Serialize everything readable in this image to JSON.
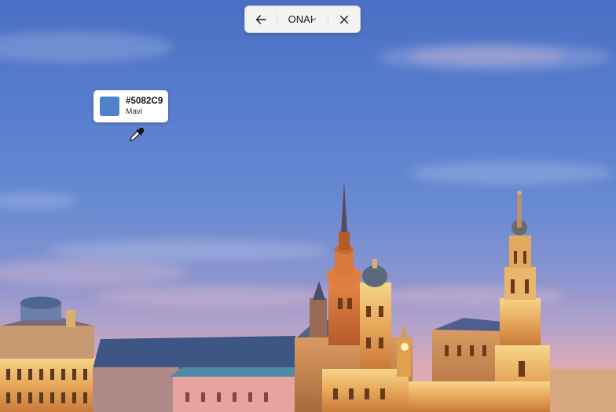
{
  "toolbar": {
    "back_icon": "arrow-left-icon",
    "mode_label": "ONAI",
    "dropdown_icon": "chevron-down-icon",
    "close_icon": "close-icon"
  },
  "color_picker": {
    "hex": "#5082C9",
    "name": "Mavi",
    "swatch_color": "#5082C9",
    "cursor_icon": "eyedropper-icon"
  },
  "background": {
    "description_icon": "city-skyline-photo",
    "accent_colors": {
      "sky_top": "#4a6fc4",
      "sky_bottom": "#e6b1a6",
      "building_light": "#f2c46a",
      "building_shadow": "#8a5a38",
      "roof": "#3c5a8a"
    }
  }
}
